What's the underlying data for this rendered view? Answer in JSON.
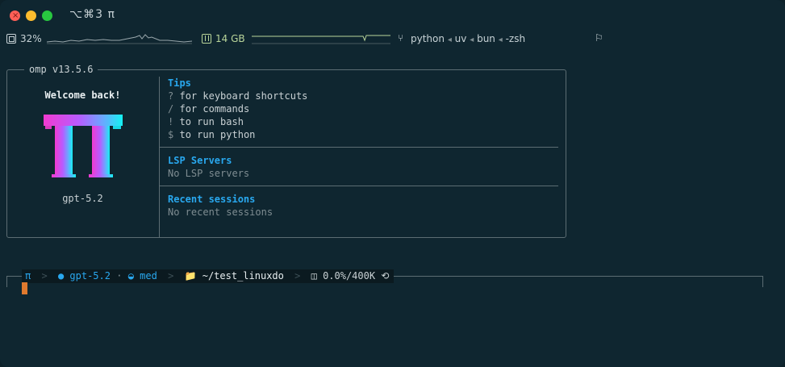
{
  "window": {
    "title": "⌥⌘3  π"
  },
  "statusbar": {
    "cpu": "32%",
    "memory": "14 GB",
    "processes": [
      "python",
      "uv",
      "bun",
      "-zsh"
    ],
    "process_sep": "◂",
    "icons": {
      "cpu": "cpu-icon",
      "memory": "memory-icon",
      "branch": "branch-icon",
      "flag": "flag-icon"
    }
  },
  "omp": {
    "version": "omp v13.5.6",
    "welcome": "Welcome back!",
    "model": "gpt-5.2",
    "tips": {
      "title": "Tips",
      "items": [
        {
          "key": "?",
          "text": "for keyboard shortcuts"
        },
        {
          "key": "/",
          "text": "for commands"
        },
        {
          "key": "!",
          "text": "to run bash"
        },
        {
          "key": "$",
          "text": "to run python"
        }
      ]
    },
    "lsp": {
      "title": "LSP Servers",
      "empty": "No LSP servers"
    },
    "recent": {
      "title": "Recent sessions",
      "empty": "No recent sessions"
    }
  },
  "prompt": {
    "pi": "π",
    "model": "gpt-5.2",
    "effort": "med",
    "cwd": "~/test_linuxdo",
    "context": "0.0%/400K",
    "chevron": ">",
    "dot": "·"
  },
  "colors": {
    "background": "#0f2630",
    "accent": "#29a8ef",
    "cursor": "#e07a2e",
    "memory": "#b9d59a"
  }
}
